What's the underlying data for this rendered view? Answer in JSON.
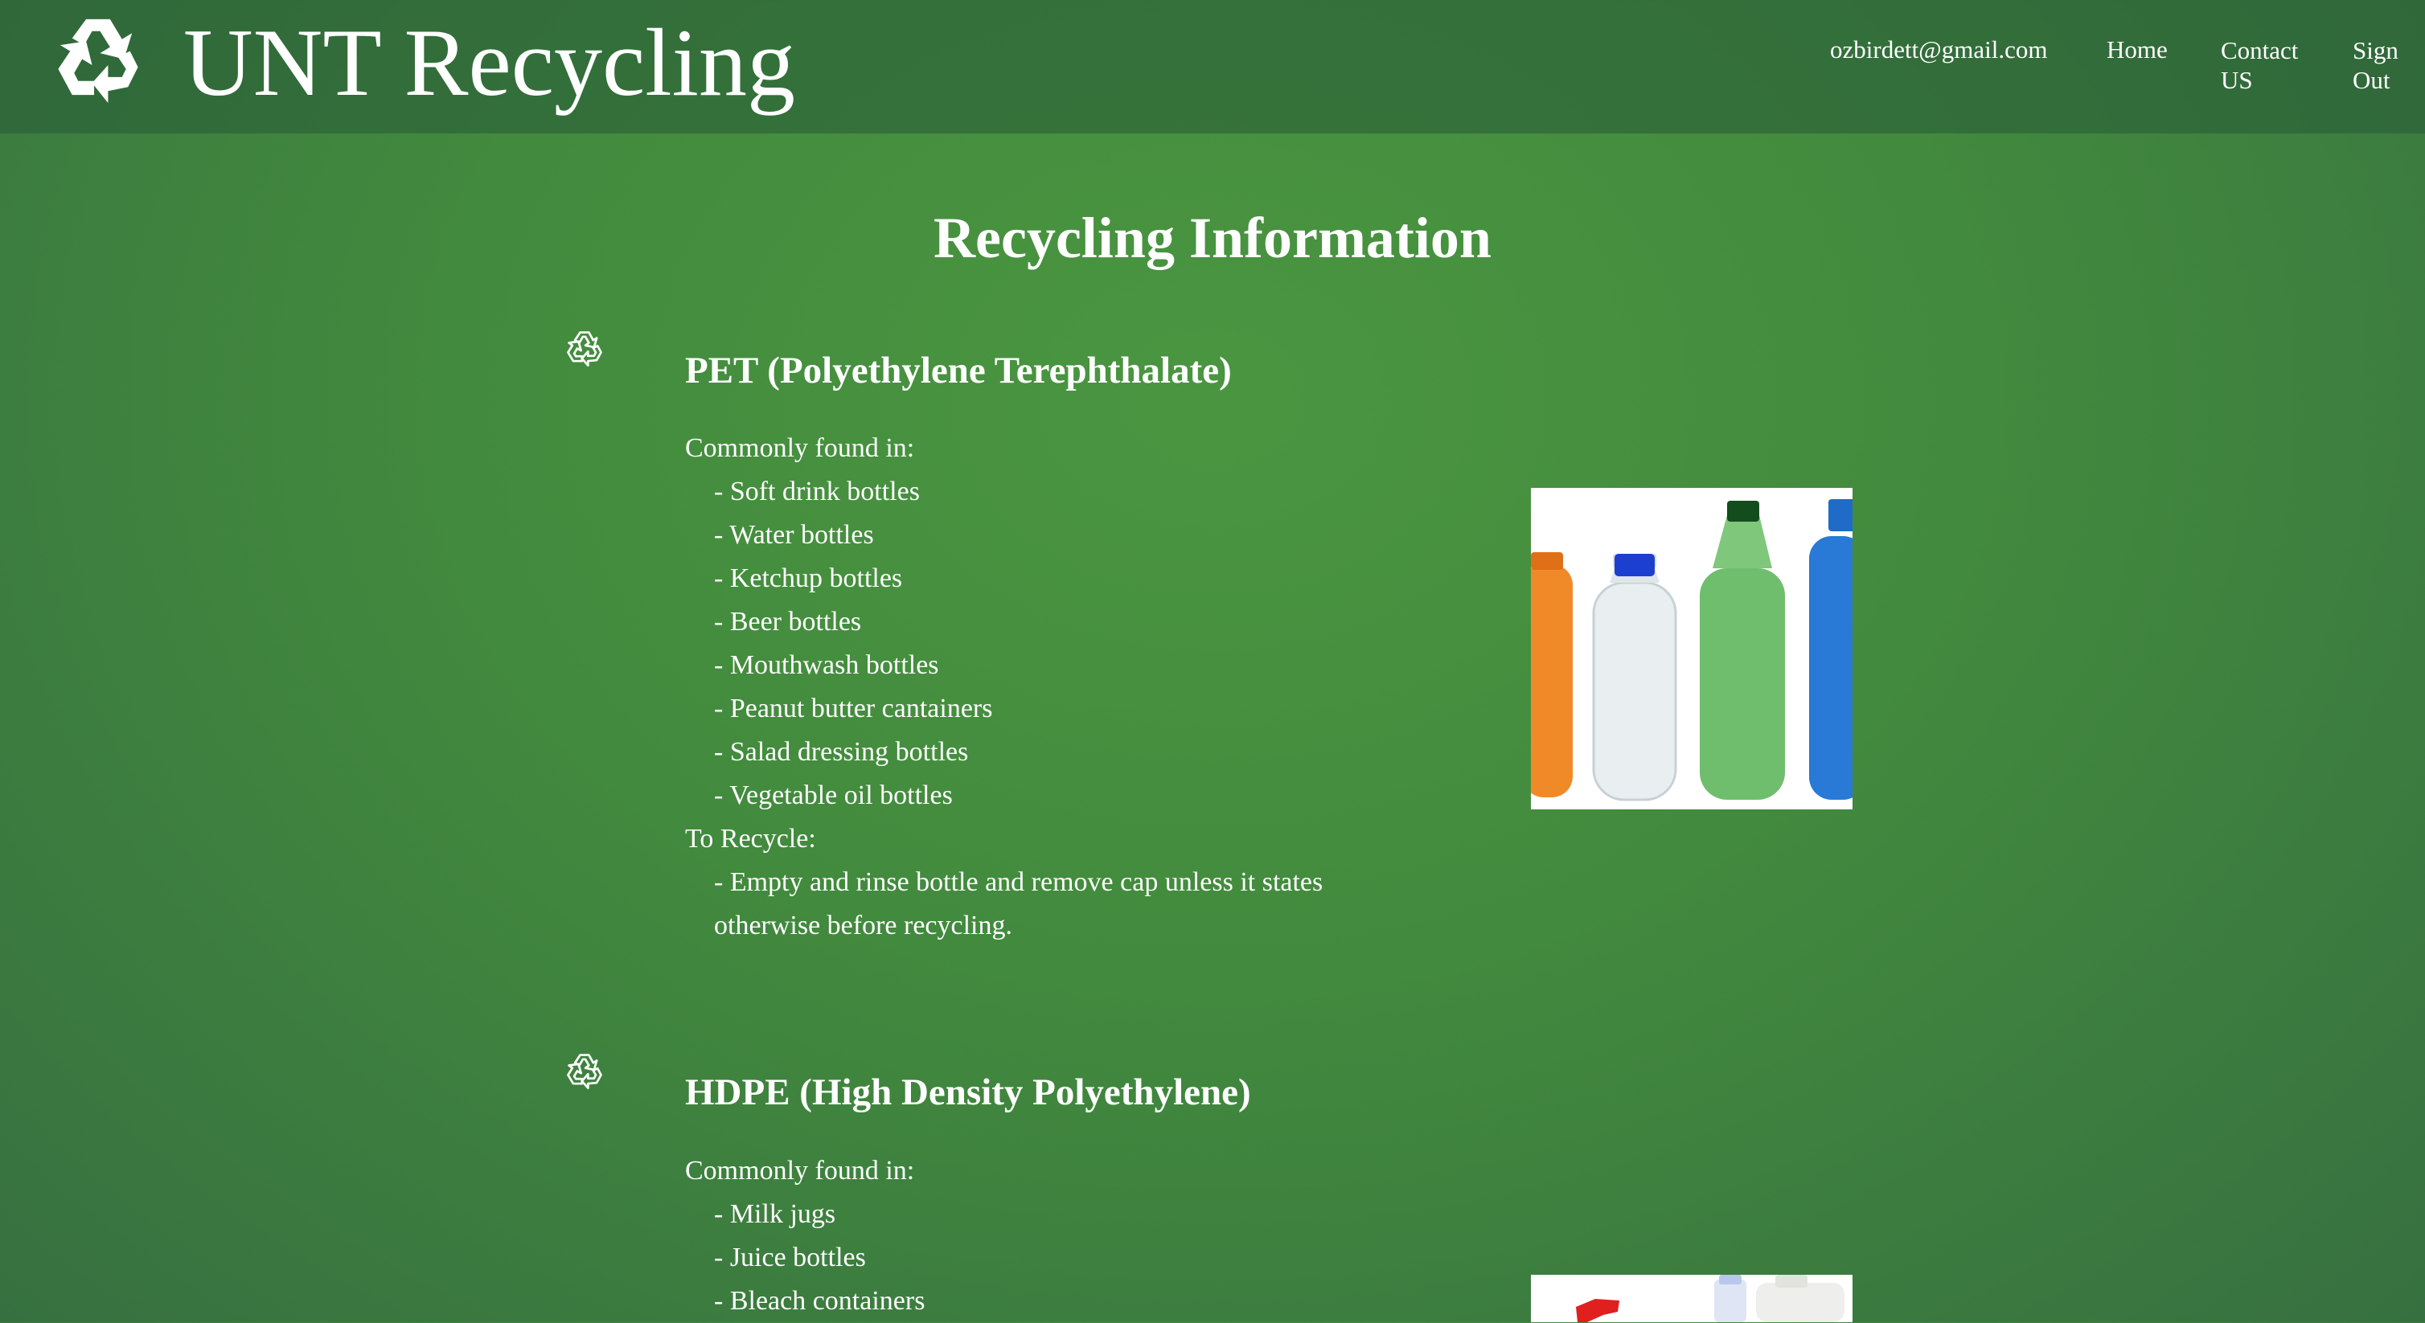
{
  "header": {
    "brand": "UNT Recycling",
    "logo_icon": "recycle-icon",
    "nav": {
      "email": "ozbirdett@gmail.com",
      "home": "Home",
      "contact": "Contact US",
      "signout": "Sign Out"
    }
  },
  "main": {
    "title": "Recycling Information",
    "sections": [
      {
        "icon": "recycle-symbol-icon",
        "title": "PET (Polyethylene Terephthalate)",
        "found_label": "Commonly found in:",
        "items": [
          "- Soft drink bottles",
          "- Water bottles",
          "- Ketchup bottles",
          "- Beer bottles",
          "- Mouthwash bottles",
          "- Peanut butter cantainers",
          "- Salad dressing bottles",
          "- Vegetable oil bottles"
        ],
        "recycle_label": "To Recycle:",
        "recycle_steps": [
          "- Empty and rinse bottle and remove cap unless it states otherwise before recycling."
        ]
      },
      {
        "icon": "recycle-symbol-icon",
        "title": "HDPE (High Density Polyethylene)",
        "found_label": "Commonly found in:",
        "items": [
          "- Milk jugs",
          "- Juice bottles",
          "- Bleach containers"
        ]
      }
    ]
  },
  "colors": {
    "background": "#428a3e",
    "header": "#3a7a46",
    "text": "#ffffff"
  }
}
